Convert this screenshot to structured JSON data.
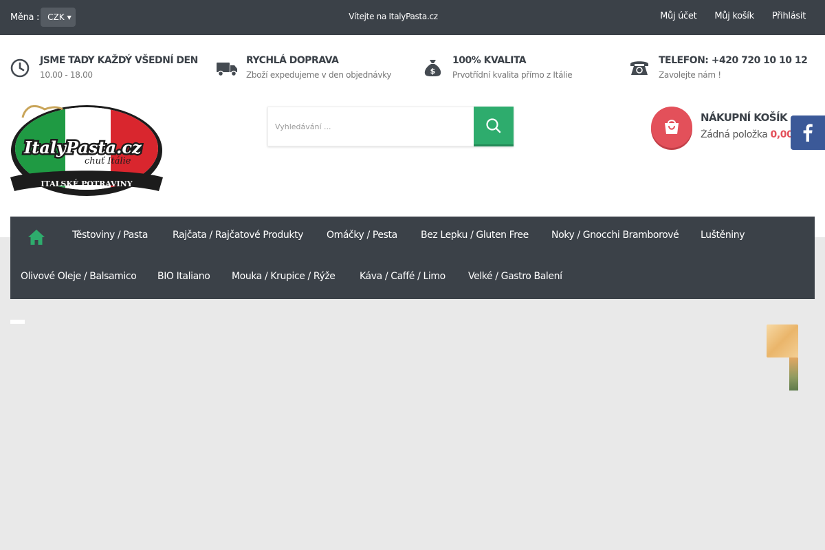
{
  "topbar": {
    "currency_label": "Měna :",
    "currency_value": "CZK",
    "welcome": "Vítejte na ItalyPasta.cz",
    "links": [
      "Můj účet",
      "Můj košík",
      "Přihlásit"
    ]
  },
  "info": [
    {
      "icon": "clock-icon",
      "title": "JSME TADY KAŽDÝ VŠEDNÍ DEN",
      "sub": "10.00 - 18.00"
    },
    {
      "icon": "truck-icon",
      "title": "RYCHLÁ DOPRAVA",
      "sub": "Zboží expedujeme v den objednávky"
    },
    {
      "icon": "money-bag-icon",
      "title": "100% KVALITA",
      "sub": "Prvotřídní kvalita přímo z Itálie"
    },
    {
      "icon": "phone-icon",
      "title": "TELEFON: +420 720 10 10 12",
      "sub": "Zavolejte nám !"
    }
  ],
  "logo": {
    "main": "ItalyPasta.cz",
    "tagline": "chuť Itálie",
    "banner": "ITALSKÉ POTRAVINY"
  },
  "search": {
    "placeholder": "Vyhledávání ..."
  },
  "cart": {
    "title": "NÁKUPNÍ KOŠÍK",
    "empty_text": "Žádná položka",
    "price": "0,00"
  },
  "nav": {
    "row1": [
      "Těstoviny / Pasta",
      "Rajčata / Rajčatové Produkty",
      "Omáčky / Pesta",
      "Bez Lepku / Gluten Free",
      "Noky / Gnocchi Bramborové",
      "Luštěniny"
    ],
    "row2": [
      "Olivové Oleje / Balsamico",
      "BIO Italiano",
      "Mouka / Krupice / Rýže",
      "Káva / Caffé / Limo",
      "Velké / Gastro Balení"
    ]
  },
  "colors": {
    "dark": "#3b4148",
    "green": "#2eac6d",
    "red": "#e3505a",
    "facebook": "#3b5998"
  }
}
